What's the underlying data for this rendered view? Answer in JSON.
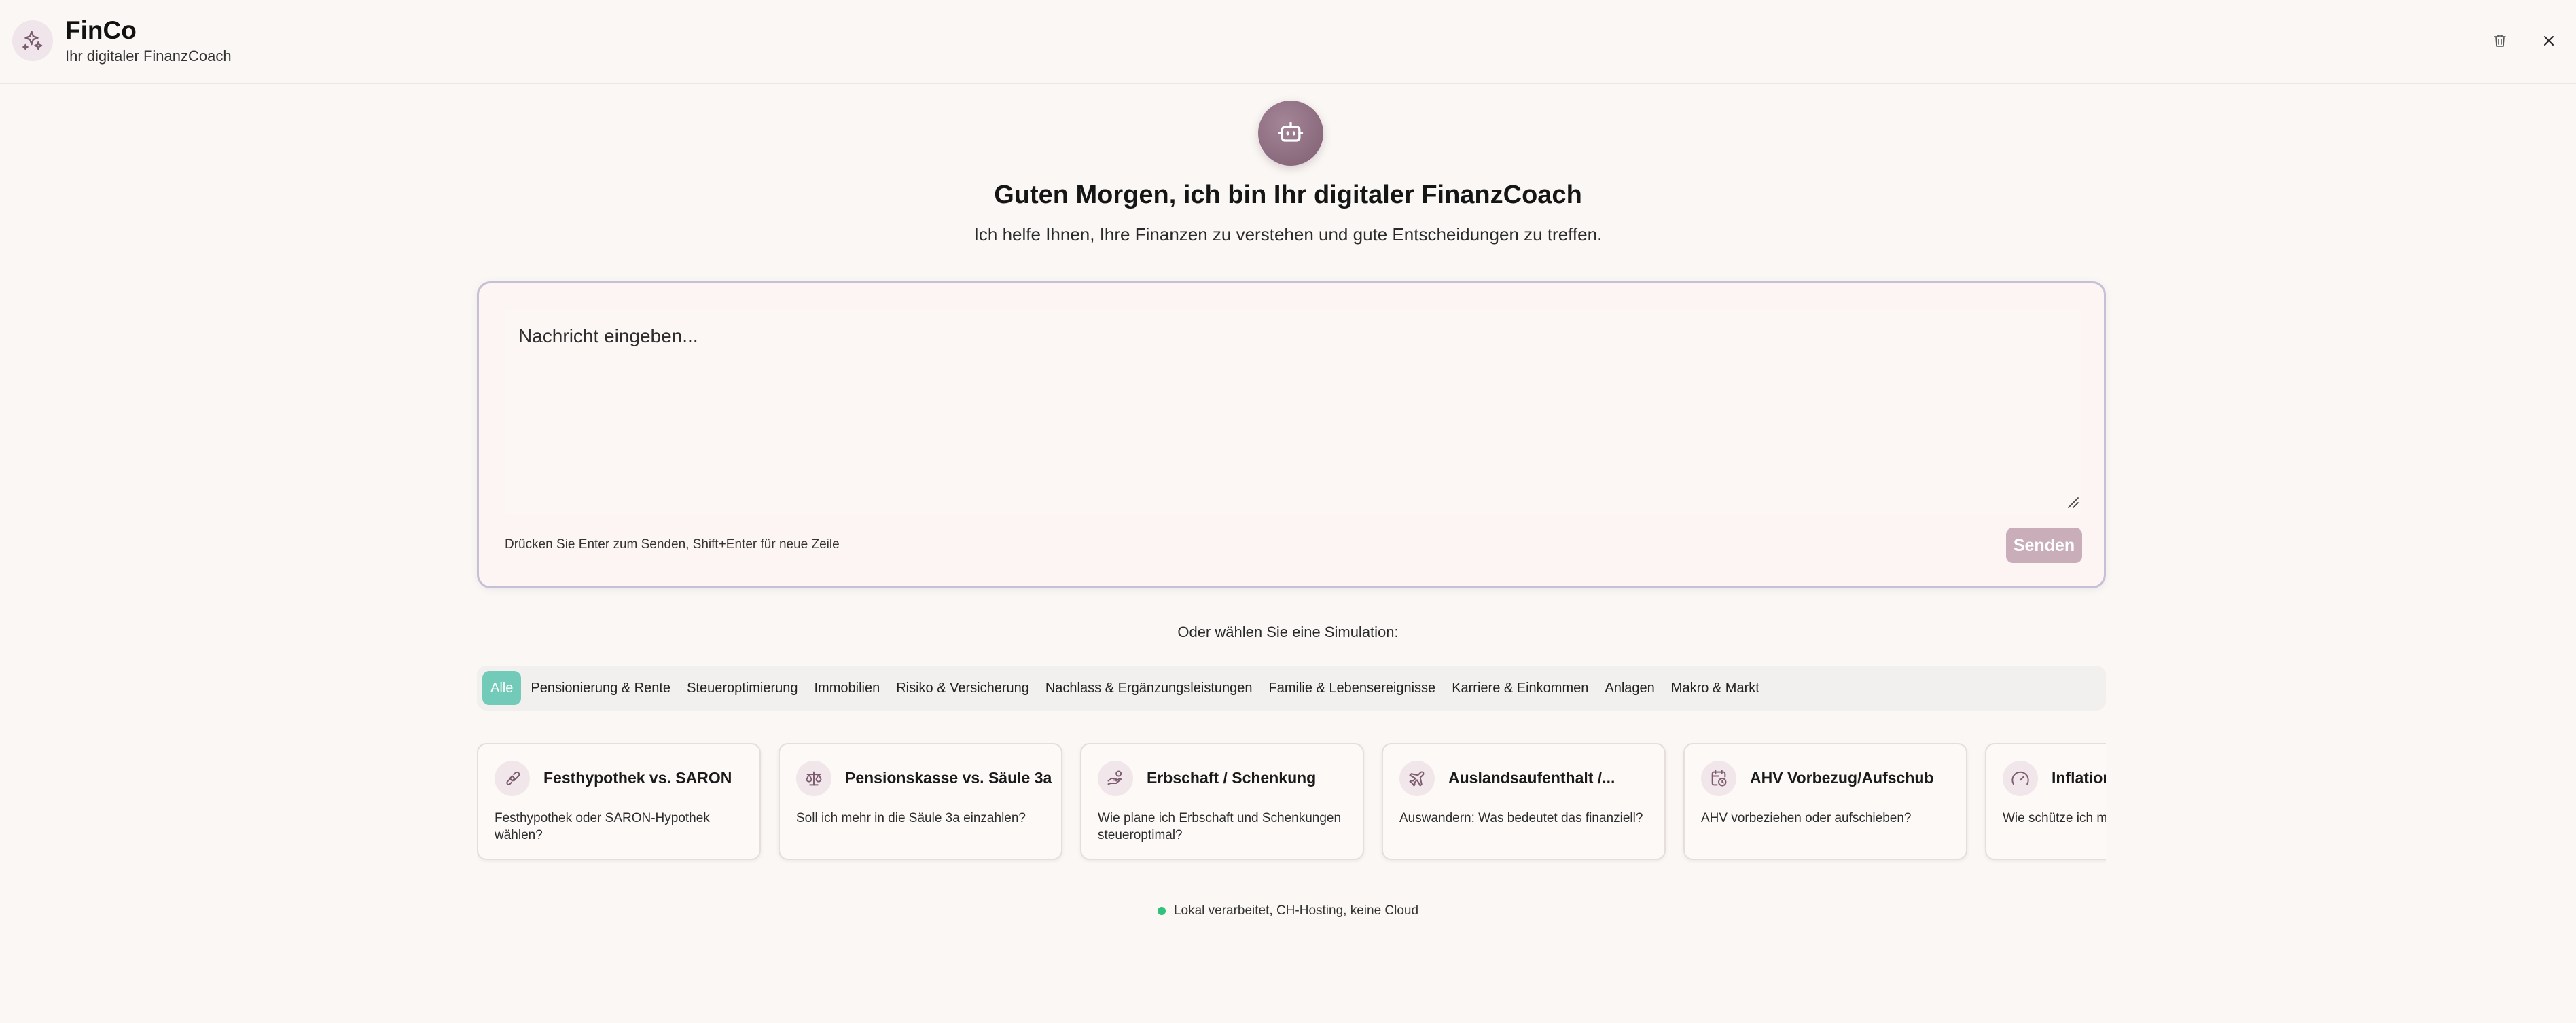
{
  "header": {
    "title": "FinCo",
    "subtitle": "Ihr digitaler FinanzCoach",
    "logo_icon": "sparkles-icon",
    "actions": [
      "trash-icon",
      "close-icon"
    ]
  },
  "hero": {
    "avatar_icon": "bot-icon",
    "title": "Guten Morgen, ich bin Ihr digitaler FinanzCoach",
    "subtitle": "Ich helfe Ihnen, Ihre Finanzen zu verstehen und gute Entscheidungen zu treffen."
  },
  "composer": {
    "placeholder": "Nachricht eingeben...",
    "value": "",
    "hint": "Drücken Sie Enter zum Senden, Shift+Enter für neue Zeile",
    "send_label": "Senden"
  },
  "simulations": {
    "heading": "Oder wählen Sie eine Simulation:",
    "categories": [
      {
        "label": "Alle",
        "active": true
      },
      {
        "label": "Pensionierung & Rente",
        "active": false
      },
      {
        "label": "Steueroptimierung",
        "active": false
      },
      {
        "label": "Immobilien",
        "active": false
      },
      {
        "label": "Risiko & Versicherung",
        "active": false
      },
      {
        "label": "Nachlass & Ergänzungsleistungen",
        "active": false
      },
      {
        "label": "Familie & Lebensereignisse",
        "active": false
      },
      {
        "label": "Karriere & Einkommen",
        "active": false
      },
      {
        "label": "Anlagen",
        "active": false
      },
      {
        "label": "Makro & Markt",
        "active": false
      }
    ],
    "cards": [
      {
        "icon": "handshake-icon",
        "title": "Festhypothek vs. SARON",
        "desc": "Festhypothek oder SARON-Hypothek wählen?"
      },
      {
        "icon": "scale-icon",
        "title": "Pensionskasse vs. Säule 3a",
        "desc": "Soll ich mehr in die Säule 3a einzahlen?"
      },
      {
        "icon": "hand-coins-icon",
        "title": "Erbschaft / Schenkung",
        "desc": "Wie plane ich Erbschaft und Schenkungen steueroptimal?"
      },
      {
        "icon": "plane-icon",
        "title": "Auslandsaufenthalt /...",
        "desc": "Auswandern: Was bedeutet das finanziell?"
      },
      {
        "icon": "calendar-clock-icon",
        "title": "AHV Vorbezug/Aufschub",
        "desc": "AHV vorbeziehen oder aufschieben?"
      },
      {
        "icon": "gauge-icon",
        "title": "Inflation",
        "desc": "Wie schütze ich m Inflation?"
      }
    ]
  },
  "footer": {
    "status": "Lokal verarbeitet, CH-Hosting, keine Cloud",
    "status_color": "#2fc27a"
  },
  "colors": {
    "accent": "#72cbb8",
    "brand": "#8d6b80",
    "send_disabled": "#c9aeba"
  }
}
